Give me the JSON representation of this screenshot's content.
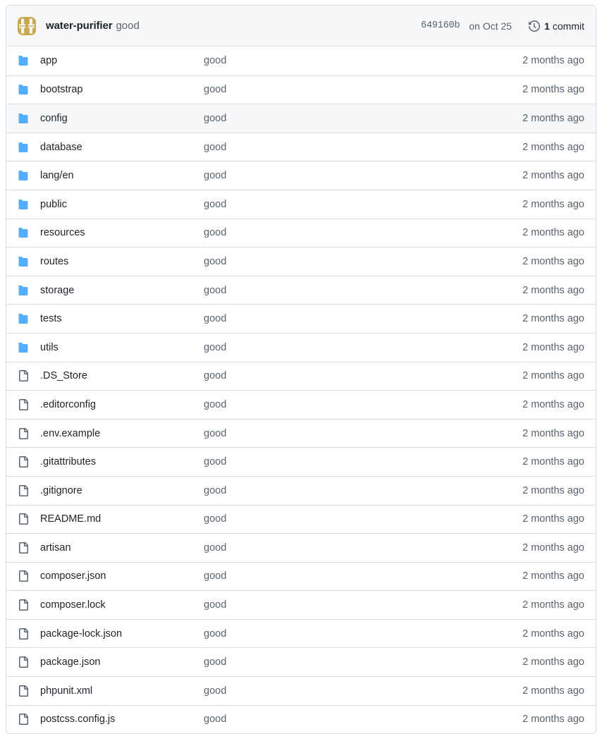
{
  "header": {
    "avatar_icon": "identicon-avatar",
    "avatar_color": "#c9a94f",
    "author": "water-purifier",
    "commit_message": "good",
    "sha": "649160b",
    "date": "on Oct 25",
    "history_icon": "history-icon",
    "commit_count": "1",
    "commit_count_label": "commit"
  },
  "colors": {
    "folder_icon": "#54aeff",
    "file_icon": "#59636e",
    "border": "#d8dee4",
    "header_bg": "#f6f8fa",
    "row_hover_bg": "#f6f8fa",
    "text_primary": "#1f2328",
    "text_muted": "#59636e"
  },
  "rows": [
    {
      "icon": "folder-icon",
      "type": "folder",
      "name": "app",
      "commit": "good",
      "time": "2 months ago",
      "hovered": false
    },
    {
      "icon": "folder-icon",
      "type": "folder",
      "name": "bootstrap",
      "commit": "good",
      "time": "2 months ago",
      "hovered": false
    },
    {
      "icon": "folder-icon",
      "type": "folder",
      "name": "config",
      "commit": "good",
      "time": "2 months ago",
      "hovered": true
    },
    {
      "icon": "folder-icon",
      "type": "folder",
      "name": "database",
      "commit": "good",
      "time": "2 months ago",
      "hovered": false
    },
    {
      "icon": "folder-icon",
      "type": "folder",
      "name": "lang/en",
      "commit": "good",
      "time": "2 months ago",
      "hovered": false
    },
    {
      "icon": "folder-icon",
      "type": "folder",
      "name": "public",
      "commit": "good",
      "time": "2 months ago",
      "hovered": false
    },
    {
      "icon": "folder-icon",
      "type": "folder",
      "name": "resources",
      "commit": "good",
      "time": "2 months ago",
      "hovered": false
    },
    {
      "icon": "folder-icon",
      "type": "folder",
      "name": "routes",
      "commit": "good",
      "time": "2 months ago",
      "hovered": false
    },
    {
      "icon": "folder-icon",
      "type": "folder",
      "name": "storage",
      "commit": "good",
      "time": "2 months ago",
      "hovered": false
    },
    {
      "icon": "folder-icon",
      "type": "folder",
      "name": "tests",
      "commit": "good",
      "time": "2 months ago",
      "hovered": false
    },
    {
      "icon": "folder-icon",
      "type": "folder",
      "name": "utils",
      "commit": "good",
      "time": "2 months ago",
      "hovered": false
    },
    {
      "icon": "file-icon",
      "type": "file",
      "name": ".DS_Store",
      "commit": "good",
      "time": "2 months ago",
      "hovered": false
    },
    {
      "icon": "file-icon",
      "type": "file",
      "name": ".editorconfig",
      "commit": "good",
      "time": "2 months ago",
      "hovered": false
    },
    {
      "icon": "file-icon",
      "type": "file",
      "name": ".env.example",
      "commit": "good",
      "time": "2 months ago",
      "hovered": false
    },
    {
      "icon": "file-icon",
      "type": "file",
      "name": ".gitattributes",
      "commit": "good",
      "time": "2 months ago",
      "hovered": false
    },
    {
      "icon": "file-icon",
      "type": "file",
      "name": ".gitignore",
      "commit": "good",
      "time": "2 months ago",
      "hovered": false
    },
    {
      "icon": "file-icon",
      "type": "file",
      "name": "README.md",
      "commit": "good",
      "time": "2 months ago",
      "hovered": false
    },
    {
      "icon": "file-icon",
      "type": "file",
      "name": "artisan",
      "commit": "good",
      "time": "2 months ago",
      "hovered": false
    },
    {
      "icon": "file-icon",
      "type": "file",
      "name": "composer.json",
      "commit": "good",
      "time": "2 months ago",
      "hovered": false
    },
    {
      "icon": "file-icon",
      "type": "file",
      "name": "composer.lock",
      "commit": "good",
      "time": "2 months ago",
      "hovered": false
    },
    {
      "icon": "file-icon",
      "type": "file",
      "name": "package-lock.json",
      "commit": "good",
      "time": "2 months ago",
      "hovered": false
    },
    {
      "icon": "file-icon",
      "type": "file",
      "name": "package.json",
      "commit": "good",
      "time": "2 months ago",
      "hovered": false
    },
    {
      "icon": "file-icon",
      "type": "file",
      "name": "phpunit.xml",
      "commit": "good",
      "time": "2 months ago",
      "hovered": false
    },
    {
      "icon": "file-icon",
      "type": "file",
      "name": "postcss.config.js",
      "commit": "good",
      "time": "2 months ago",
      "hovered": false
    }
  ]
}
